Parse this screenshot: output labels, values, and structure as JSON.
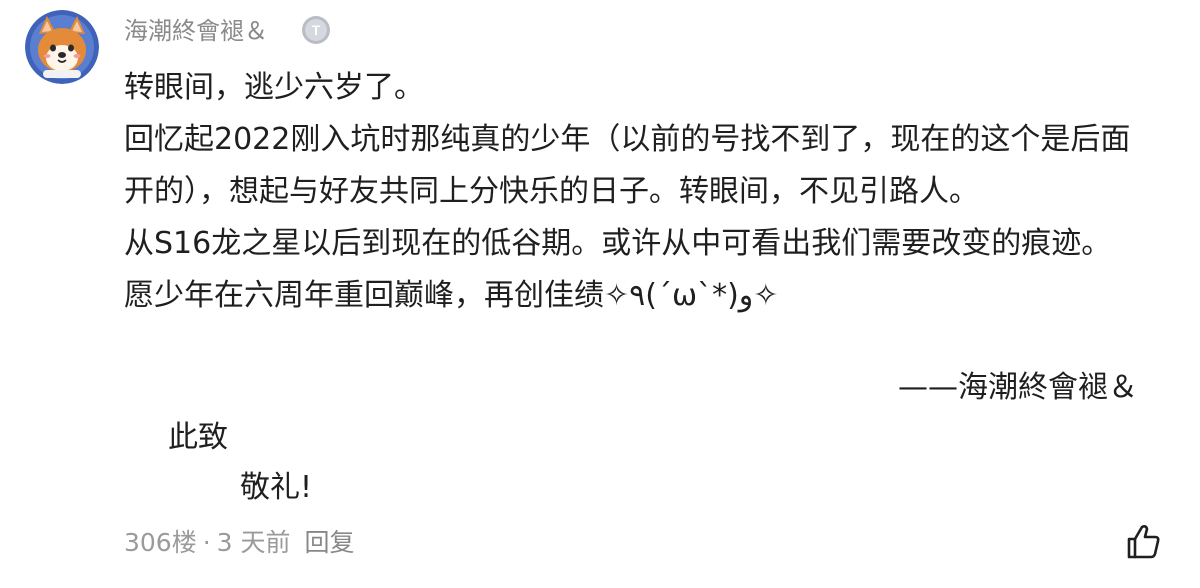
{
  "comment": {
    "username": "海潮終會褪＆",
    "level_badge": "T",
    "body_lines": [
      "转眼间，逃少六岁了。",
      "回忆起2022刚入坑时那纯真的少年（以前的号找不到了，现在的这个是后面开的），想起与好友共同上分快乐的日子。转眼间，不见引路人。",
      "从S16龙之星以后到现在的低谷期。或许从中可看出我们需要改变的痕迹。",
      "愿少年在六周年重回巅峰，再创佳绩✧٩(ˊωˋ*)و✧"
    ],
    "signature": "——海潮終會褪＆",
    "closing_line_1": "此致",
    "closing_line_2": "敬礼!",
    "floor": "306楼",
    "separator": "·",
    "time": "3 天前",
    "reply_label": "回复"
  },
  "icons": {
    "avatar": "shiba-dog-avatar",
    "level_badge": "level-badge-icon",
    "like": "thumbs-up-icon"
  },
  "colors": {
    "username": "#8a8a8a",
    "body_text": "#1f1f1f",
    "meta_text": "#9a9a9a",
    "avatar_bg": "#3f63b8",
    "badge_bg": "#b9bcc5"
  }
}
